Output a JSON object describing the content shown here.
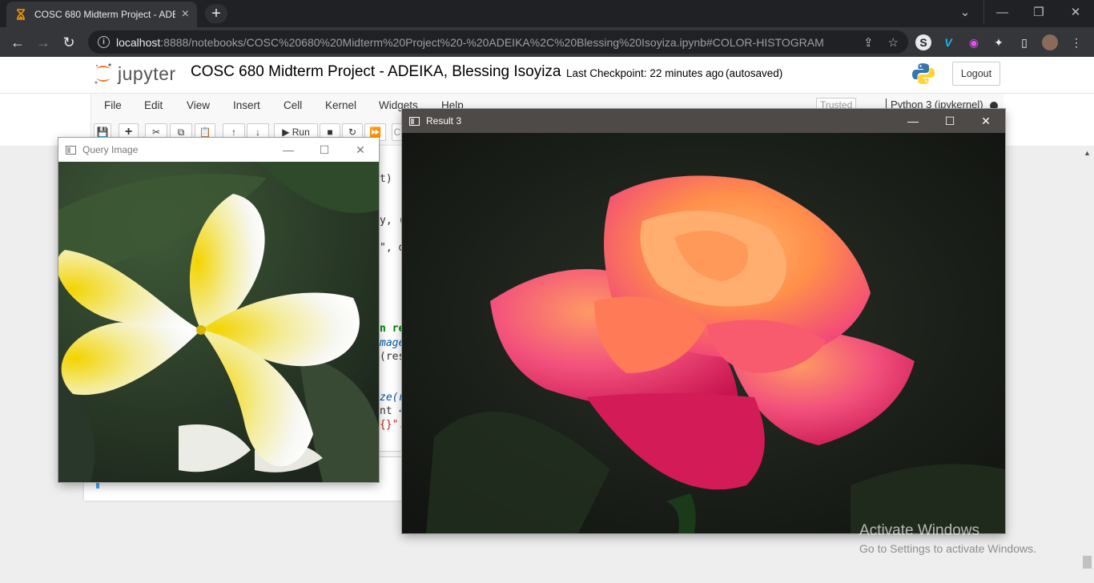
{
  "browser": {
    "tab_title": "COSC 680 Midterm Project - ADE",
    "new_tab_symbol": "+",
    "url_host": "localhost",
    "url_rest": ":8888/notebooks/COSC%20680%20Midterm%20Project%20-%20ADEIKA%2C%20Blessing%20Isoyiza.ipynb#COLOR-HISTOGRAM",
    "window_controls": {
      "tab_search": "⌄",
      "minimize": "—",
      "restore": "❐",
      "close": "✕"
    },
    "nav": {
      "back": "←",
      "forward": "→",
      "reload": "↻"
    },
    "omnibox_icons": {
      "info": "i",
      "share": "⇪",
      "star": "☆"
    },
    "extensions": [
      "S",
      "V",
      "◉",
      "✦",
      "▯",
      "⋮"
    ]
  },
  "jupyter": {
    "logo_text": "jupyter",
    "notebook_title": "COSC 680 Midterm Project - ADEIKA, Blessing Isoyiza",
    "checkpoint": "Last Checkpoint: 22 minutes ago",
    "autosave": "(autosaved)",
    "logout": "Logout",
    "menu": [
      "File",
      "Edit",
      "View",
      "Insert",
      "Cell",
      "Kernel",
      "Widgets",
      "Help"
    ],
    "trusted": "Trusted",
    "kernel": "Python 3 (ipykernel)",
    "toolbar": {
      "save": "💾",
      "add": "+",
      "cut": "✂",
      "copy": "⧉",
      "paste": "📋",
      "up": "↑",
      "down": "↓",
      "run": "▶ Run",
      "stop": "■",
      "restart": "↻",
      "fast_forward": "⏩",
      "cell_type": "C"
    }
  },
  "code_fragments": [
    "t)",
    "y, (",
    "\", d",
    "n re",
    "mage",
    "(res",
    "ze(r",
    "nt +",
    "{}\"."
  ],
  "query_window": {
    "title": "Query Image",
    "minimize": "—",
    "maximize": "☐",
    "close": "✕"
  },
  "result_window": {
    "title": "Result 3",
    "minimize": "—",
    "maximize": "☐",
    "close": "✕"
  },
  "watermark": {
    "line1": "Activate Windows",
    "line2": "Go to Settings to activate Windows."
  },
  "colors": {
    "accent_jupyter": "#f37726",
    "chrome_dark": "#202124",
    "result_titlebar": "#4d4a48"
  }
}
